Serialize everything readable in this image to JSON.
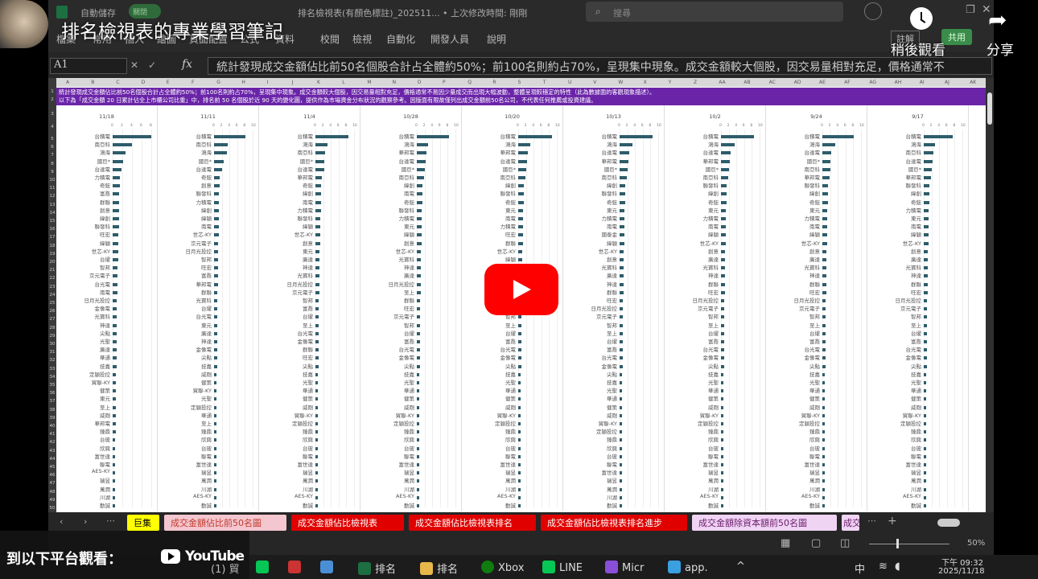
{
  "video": {
    "title": "排名檢視表的專業學習筆記",
    "watch_later": "稍後觀看",
    "share": "分享",
    "watch_on": "到以下平台觀看：",
    "youtube": "YouTube"
  },
  "excel": {
    "autosave_label": "自動儲存",
    "autosave_state": "關閉",
    "file_title": "排名檢視表(有顏色標註)_202511... • 上次修改時間: 剛剛",
    "search_placeholder": "搜尋",
    "comments": "註解",
    "share": "共用",
    "ribbon_tabs": [
      "檔案",
      "常用",
      "插入",
      "繪圖",
      "頁面配置",
      "公式",
      "資料",
      "校閱",
      "檢視",
      "自動化",
      "開發人員",
      "說明"
    ],
    "name_box": "A1",
    "formula": "統計發現成交金額佔比前50名個股合計占全體約50%；前100名則約占70%，呈現集中現象。成交金額較大個股，因交易量相對充足，價格通常不",
    "columns": [
      "A",
      "B",
      "C",
      "D",
      "E",
      "F",
      "G",
      "H",
      "I",
      "J",
      "K",
      "L",
      "M",
      "N",
      "O",
      "P",
      "Q",
      "R",
      "S",
      "T",
      "U",
      "V",
      "W",
      "X",
      "Y",
      "Z",
      "AA",
      "AB",
      "AC",
      "AD",
      "AE",
      "AF",
      "AG",
      "AH",
      "AI",
      "AJ",
      "AK"
    ],
    "banner": [
      "統計發現成交金額佔比前50名個股合計占全體約50%；前100名則約占70%，呈現集中現象。成交金額較大個股，因交易量相對充足，價格通常不易因少量成交而出現大幅波動，整體呈現較穩定的特性（此為數據面的客觀現象描述）。",
      "以下為「成交金額 20 日累計佔全上市櫃公司比重」中，排名前 50 名個股於近 90 天的變化圖，提供作為市場資金分布狀況的觀察參考。因版面有限故僅列出成交金額前50名公司，不代表任何推薦或投資建議。"
    ],
    "sheet_tabs": [
      {
        "label": "巨集",
        "color": "#ffff00",
        "fg": "#000"
      },
      {
        "label": "成交金額佔比前50名圖",
        "color": "#f4c6cf",
        "fg": "#c0392b"
      },
      {
        "label": "成交金額佔比檢視表",
        "color": "#e00000",
        "fg": "#fff"
      },
      {
        "label": "成交金額佔比檢視表排名",
        "color": "#e00000",
        "fg": "#fff"
      },
      {
        "label": "成交金額佔比檢視表排名進步",
        "color": "#e00000",
        "fg": "#fff"
      },
      {
        "label": "成交金額除資本額前50名圖",
        "color": "#f0d4f4",
        "fg": "#6a1b6a"
      },
      {
        "label": "成交",
        "color": "#f0d4f4",
        "fg": "#6a1b6a"
      }
    ],
    "zoom": "50%"
  },
  "taskbar": {
    "items": [
      "(1) 貿",
      "排名",
      "排名",
      "Xbox",
      "LINE",
      "Micr",
      "app."
    ],
    "ime": "中",
    "time": "下午 09:32",
    "date": "2025/11/18"
  },
  "chart_data": {
    "type": "bar",
    "orientation": "horizontal",
    "unit": "%",
    "panels": [
      {
        "date": "11/18",
        "ticks": [
          "0",
          "2",
          "4",
          "6",
          "8"
        ],
        "max": 8.5,
        "names": [
          "台積電",
          "南亞科",
          "鴻海",
          "國巨*",
          "台達電",
          "力積電",
          "奇鋐",
          "富喬",
          "群聯",
          "創意",
          "緯創",
          "聯發科",
          "旺宏",
          "緯穎",
          "世芯-KY",
          "台燿",
          "智邦",
          "京元電子",
          "台光電",
          "南電",
          "日月光投控",
          "金像電",
          "光寶科",
          "神達",
          "尖點",
          "光聖",
          "廣達",
          "華通",
          "技嘉",
          "定穎投控",
          "貿聯-KY",
          "健策",
          "東元",
          "至上",
          "威剛",
          "華邦電",
          "臻鼎",
          "台玻",
          "欣興",
          "富世達",
          "聯電",
          "AES-KY",
          "瑞昱",
          "萬潤",
          "川湖",
          "勤誠"
        ],
        "values": [
          8.0,
          4.0,
          2.6,
          2.2,
          1.8,
          1.5,
          1.5,
          1.4,
          1.4,
          1.4,
          1.3,
          1.3,
          1.2,
          1.2,
          1.1,
          1.1,
          1.0,
          1.0,
          1.0,
          0.95,
          0.9,
          0.9,
          0.85,
          0.85,
          0.8,
          0.8,
          0.8,
          0.75,
          0.75,
          0.7,
          0.7,
          0.7,
          0.65,
          0.65,
          0.6,
          0.6,
          0.6,
          0.55,
          0.55,
          0.55,
          0.5,
          0.5,
          0.5,
          0.45,
          0.45,
          0.45
        ]
      },
      {
        "date": "11/11",
        "ticks": [
          "0",
          "2",
          "4",
          "6",
          "8",
          "10"
        ],
        "max": 10,
        "names": [
          "台積電",
          "南亞科",
          "鴻海",
          "國巨*",
          "台達電",
          "奇鋐",
          "創意",
          "聯發科",
          "力積電",
          "緯創",
          "緯穎",
          "南電",
          "世芯-KY",
          "京元電子",
          "日月光投控",
          "智邦",
          "旺宏",
          "富喬",
          "華邦電",
          "群聯",
          "光寶科",
          "台燿",
          "台光電",
          "東元",
          "廣達",
          "神達",
          "金像電",
          "尖點",
          "技嘉",
          "威剛",
          "健策",
          "貿聯-KY",
          "光聖",
          "定穎投控",
          "華通",
          "至上",
          "臻鼎",
          "欣興",
          "台玻",
          "聯電",
          "富世達",
          "瑞昱",
          "萬潤",
          "川湖",
          "AES-KY",
          "勤誠"
        ],
        "values": [
          8.2,
          3.5,
          3.3,
          2.4,
          2.0,
          1.5,
          1.4,
          1.3,
          1.3,
          1.3,
          1.3,
          1.2,
          1.2,
          1.1,
          1.1,
          1.0,
          1.0,
          1.0,
          0.95,
          0.9,
          0.9,
          0.9,
          0.85,
          0.85,
          0.8,
          0.8,
          0.8,
          0.75,
          0.75,
          0.7,
          0.7,
          0.7,
          0.65,
          0.65,
          0.6,
          0.6,
          0.6,
          0.55,
          0.55,
          0.55,
          0.5,
          0.5,
          0.5,
          0.45,
          0.45,
          0.45
        ]
      },
      {
        "date": "11/4",
        "ticks": [
          "0",
          "2",
          "4",
          "6",
          "8",
          "10"
        ],
        "max": 10,
        "names": [
          "台積電",
          "鴻海",
          "南亞科",
          "國巨*",
          "台達電",
          "華邦電",
          "奇鋐",
          "緯創",
          "南電",
          "力積電",
          "聯發科",
          "緯穎",
          "世芯-KY",
          "創意",
          "東元",
          "廣達",
          "神達",
          "光寶科",
          "日月光投控",
          "京元電子",
          "智邦",
          "富喬",
          "台燿",
          "至上",
          "台光電",
          "金像電",
          "群聯",
          "旺宏",
          "尖點",
          "技嘉",
          "光聖",
          "華通",
          "健策",
          "威剛",
          "貿聯-KY",
          "定穎投控",
          "臻鼎",
          "欣興",
          "台玻",
          "聯電",
          "富世達",
          "瑞昱",
          "萬潤",
          "川湖",
          "AES-KY",
          "勤誠"
        ],
        "values": [
          8.6,
          3.2,
          2.5,
          2.3,
          2.3,
          1.7,
          1.5,
          1.5,
          1.4,
          1.4,
          1.3,
          1.3,
          1.2,
          1.2,
          1.1,
          1.1,
          1.0,
          1.0,
          1.0,
          0.95,
          0.9,
          0.9,
          0.85,
          0.85,
          0.8,
          0.8,
          0.8,
          0.75,
          0.75,
          0.7,
          0.7,
          0.7,
          0.65,
          0.65,
          0.6,
          0.6,
          0.6,
          0.55,
          0.55,
          0.55,
          0.5,
          0.5,
          0.5,
          0.45,
          0.45,
          0.45
        ]
      },
      {
        "date": "10/28",
        "ticks": [
          "0",
          "2",
          "4",
          "6",
          "8",
          "10"
        ],
        "max": 10,
        "names": [
          "台積電",
          "鴻海",
          "華邦電",
          "台達電",
          "國巨*",
          "南亞科",
          "緯創",
          "南電",
          "奇鋐",
          "聯發科",
          "力積電",
          "東元",
          "緯穎",
          "創意",
          "世芯-KY",
          "光寶科",
          "神達",
          "廣達",
          "日月光投控",
          "至上",
          "群聯",
          "旺宏",
          "京元電子",
          "智邦",
          "台燿",
          "富喬",
          "台光電",
          "金像電",
          "尖點",
          "技嘉",
          "光聖",
          "華通",
          "健策",
          "威剛",
          "貿聯-KY",
          "定穎投控",
          "臻鼎",
          "欣興",
          "台玻",
          "聯電",
          "富世達",
          "瑞昱",
          "萬潤",
          "川湖",
          "AES-KY",
          "勤誠"
        ],
        "values": [
          8.4,
          3.0,
          2.4,
          2.2,
          2.0,
          1.9,
          1.5,
          1.4,
          1.4,
          1.3,
          1.3,
          1.2,
          1.2,
          1.2,
          1.1,
          1.1,
          1.0,
          1.0,
          1.0,
          0.95,
          0.9,
          0.9,
          0.85,
          0.85,
          0.8,
          0.8,
          0.8,
          0.75,
          0.75,
          0.7,
          0.7,
          0.7,
          0.65,
          0.65,
          0.6,
          0.6,
          0.6,
          0.55,
          0.55,
          0.55,
          0.5,
          0.5,
          0.5,
          0.45,
          0.45,
          0.45
        ]
      },
      {
        "date": "10/20",
        "ticks": [
          "0",
          "2",
          "4",
          "6",
          "8",
          "10"
        ],
        "max": 10,
        "names": [
          "台積電",
          "鴻海",
          "華邦電",
          "台達電",
          "國巨*",
          "南亞科",
          "緯創",
          "聯發科",
          "奇鋐",
          "東元",
          "南電",
          "力積電",
          "旺宏",
          "群聯",
          "世芯-KY",
          "緯穎",
          "創意",
          "光寶科",
          "廣達",
          "神達",
          "日月光投控",
          "京元電子",
          "智邦",
          "至上",
          "台燿",
          "富喬",
          "台光電",
          "金像電",
          "尖點",
          "技嘉",
          "光聖",
          "華通",
          "健策",
          "威剛",
          "貿聯-KY",
          "定穎投控",
          "臻鼎",
          "欣興",
          "台玻",
          "聯電",
          "富世達",
          "瑞昱",
          "萬潤",
          "川湖",
          "AES-KY",
          "勤誠"
        ],
        "values": [
          8.8,
          3.1,
          2.6,
          2.2,
          2.0,
          1.8,
          1.5,
          1.4,
          1.4,
          1.3,
          1.3,
          1.2,
          1.2,
          1.2,
          1.1,
          1.1,
          1.0,
          1.0,
          1.0,
          0.95,
          0.9,
          0.9,
          0.85,
          0.85,
          0.8,
          0.8,
          0.8,
          0.75,
          0.75,
          0.7,
          0.7,
          0.7,
          0.65,
          0.65,
          0.6,
          0.6,
          0.6,
          0.55,
          0.55,
          0.55,
          0.5,
          0.5,
          0.5,
          0.45,
          0.45,
          0.45
        ]
      },
      {
        "date": "10/13",
        "ticks": [
          "0",
          "2",
          "4",
          "6",
          "8",
          "10"
        ],
        "max": 10,
        "names": [
          "台積電",
          "鴻海",
          "台達電",
          "華邦電",
          "國巨*",
          "南亞科",
          "緯創",
          "聯發科",
          "奇鋐",
          "東元",
          "力積電",
          "南電",
          "國泰金",
          "緯穎",
          "世芯-KY",
          "創意",
          "光寶科",
          "廣達",
          "神達",
          "群聯",
          "旺宏",
          "日月光投控",
          "京元電子",
          "智邦",
          "至上",
          "台燿",
          "富喬",
          "台光電",
          "金像電",
          "尖點",
          "技嘉",
          "光聖",
          "華通",
          "健策",
          "威剛",
          "貿聯-KY",
          "定穎投控",
          "臻鼎",
          "欣興",
          "台玻",
          "聯電",
          "富世達",
          "瑞昱",
          "萬潤",
          "川湖",
          "勤誠"
        ],
        "values": [
          8.5,
          3.3,
          2.5,
          2.3,
          2.0,
          1.8,
          1.5,
          1.4,
          1.4,
          1.3,
          1.3,
          1.2,
          1.2,
          1.2,
          1.1,
          1.1,
          1.0,
          1.0,
          1.0,
          0.95,
          0.9,
          0.9,
          0.85,
          0.85,
          0.8,
          0.8,
          0.8,
          0.75,
          0.75,
          0.7,
          0.7,
          0.7,
          0.65,
          0.65,
          0.6,
          0.6,
          0.6,
          0.55,
          0.55,
          0.55,
          0.5,
          0.5,
          0.5,
          0.45,
          0.45,
          0.45
        ]
      },
      {
        "date": "10/2",
        "ticks": [
          "0",
          "2",
          "4",
          "6",
          "8",
          "10"
        ],
        "max": 10,
        "names": [
          "台積電",
          "鴻海",
          "台達電",
          "華邦電",
          "國巨*",
          "南亞科",
          "聯發科",
          "緯創",
          "奇鋐",
          "東元",
          "力積電",
          "南電",
          "緯穎",
          "世芯-KY",
          "創意",
          "廣達",
          "光寶科",
          "神達",
          "群聯",
          "旺宏",
          "日月光投控",
          "京元電子",
          "智邦",
          "至上",
          "台燿",
          "富喬",
          "台光電",
          "金像電",
          "尖點",
          "技嘉",
          "光聖",
          "華通",
          "健策",
          "威剛",
          "貿聯-KY",
          "定穎投控",
          "臻鼎",
          "欣興",
          "台玻",
          "聯電",
          "富世達",
          "瑞昱",
          "萬潤",
          "川湖",
          "AES-KY",
          "勤誠"
        ],
        "values": [
          8.6,
          3.6,
          2.4,
          2.2,
          2.0,
          1.9,
          1.5,
          1.4,
          1.4,
          1.3,
          1.3,
          1.2,
          1.2,
          1.2,
          1.1,
          1.1,
          1.0,
          1.0,
          1.0,
          0.95,
          0.9,
          0.9,
          0.85,
          0.85,
          0.8,
          0.8,
          0.8,
          0.75,
          0.75,
          0.7,
          0.7,
          0.7,
          0.65,
          0.65,
          0.6,
          0.6,
          0.6,
          0.55,
          0.55,
          0.55,
          0.5,
          0.5,
          0.5,
          0.45,
          0.45,
          0.45
        ]
      },
      {
        "date": "9/24",
        "ticks": [
          "0",
          "2",
          "4",
          "6",
          "8",
          "10"
        ],
        "max": 10,
        "names": [
          "台積電",
          "鴻海",
          "台達電",
          "國巨*",
          "南亞科",
          "華邦電",
          "聯發科",
          "緯創",
          "奇鋐",
          "東元",
          "力積電",
          "南電",
          "緯穎",
          "世芯-KY",
          "創意",
          "廣達",
          "光寶科",
          "神達",
          "群聯",
          "旺宏",
          "日月光投控",
          "京元電子",
          "智邦",
          "至上",
          "台燿",
          "富喬",
          "台光電",
          "金像電",
          "尖點",
          "技嘉",
          "光聖",
          "華通",
          "健策",
          "威剛",
          "貿聯-KY",
          "定穎投控",
          "臻鼎",
          "欣興",
          "台玻",
          "聯電",
          "富世達",
          "瑞昱",
          "萬潤",
          "川湖",
          "AES-KY",
          "勤誠"
        ],
        "values": [
          8.2,
          3.4,
          2.3,
          2.1,
          2.0,
          1.8,
          1.5,
          1.4,
          1.4,
          1.3,
          1.3,
          1.2,
          1.2,
          1.2,
          1.1,
          1.1,
          1.0,
          1.0,
          1.0,
          0.95,
          0.9,
          0.9,
          0.85,
          0.85,
          0.8,
          0.8,
          0.8,
          0.75,
          0.75,
          0.7,
          0.7,
          0.7,
          0.65,
          0.65,
          0.6,
          0.6,
          0.6,
          0.55,
          0.55,
          0.55,
          0.5,
          0.5,
          0.5,
          0.45,
          0.45,
          0.45
        ]
      },
      {
        "date": "9/17",
        "ticks": [
          "0",
          "2",
          "4",
          "6",
          "8",
          "10"
        ],
        "max": 10,
        "names": [
          "台積電",
          "鴻海",
          "南亞科",
          "台達電",
          "國巨*",
          "華邦電",
          "聯發科",
          "緯創",
          "奇鋐",
          "力積電",
          "東元",
          "南電",
          "緯穎",
          "世芯-KY",
          "創意",
          "廣達",
          "光寶科",
          "神達",
          "群聯",
          "旺宏",
          "日月光投控",
          "京元電子",
          "智邦",
          "至上",
          "台燿",
          "富喬",
          "台光電",
          "金像電",
          "尖點",
          "技嘉",
          "光聖",
          "華通",
          "健策",
          "威剛",
          "貿聯-KY",
          "定穎投控",
          "臻鼎",
          "欣興",
          "台玻",
          "聯電",
          "富世達",
          "瑞昱",
          "萬潤",
          "川湖",
          "AES-KY",
          "勤誠"
        ],
        "values": [
          7.6,
          3.0,
          2.4,
          2.2,
          2.0,
          1.8,
          1.5,
          1.4,
          1.4,
          1.3,
          1.3,
          1.2,
          1.2,
          1.2,
          1.1,
          1.1,
          1.0,
          1.0,
          1.0,
          0.95,
          0.9,
          0.9,
          0.85,
          0.85,
          0.8,
          0.8,
          0.8,
          0.75,
          0.75,
          0.7,
          0.7,
          0.7,
          0.65,
          0.65,
          0.6,
          0.6,
          0.6,
          0.55,
          0.55,
          0.55,
          0.5,
          0.5,
          0.5,
          0.45,
          0.45,
          0.45
        ]
      }
    ]
  }
}
